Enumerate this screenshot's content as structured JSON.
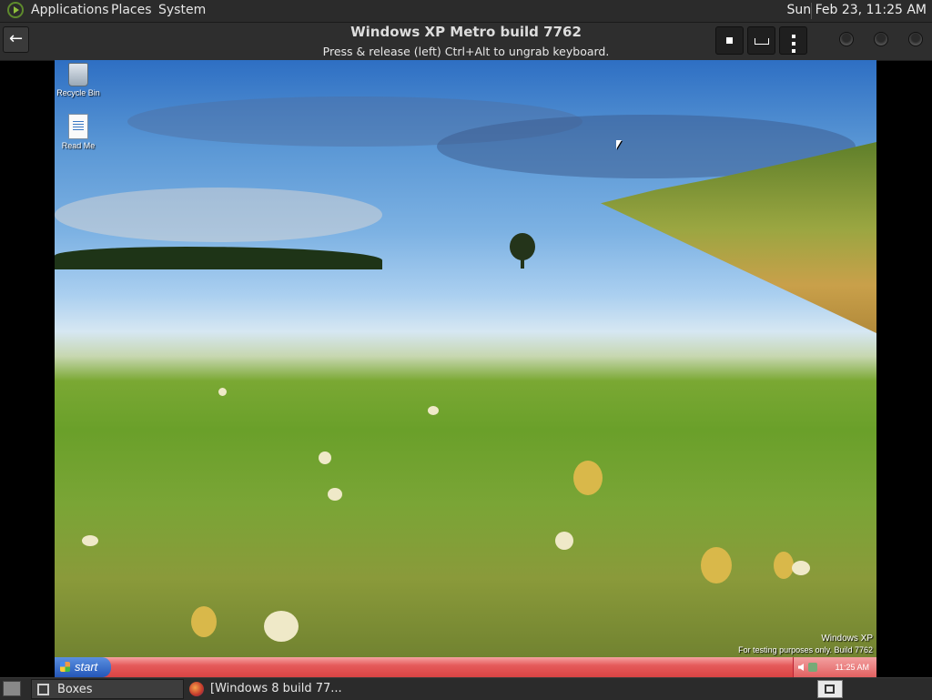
{
  "top_panel": {
    "menus": [
      "Applications",
      "Places",
      "System"
    ],
    "clock": "Sun Feb 23, 11:25 AM"
  },
  "header": {
    "title": "Windows XP Metro build 7762",
    "subtitle": "Press & release (left) Ctrl+Alt to ungrab keyboard.",
    "icons": {
      "back": "back-arrow-icon",
      "stop": "stop-icon",
      "keyboard": "keyboard-icon",
      "menu": "vertical-dots-icon"
    }
  },
  "vm": {
    "desktop_icons": [
      {
        "label": "Recycle Bin",
        "icon": "recycle-bin-icon"
      },
      {
        "label": "Read Me",
        "icon": "document-icon"
      }
    ],
    "watermark": {
      "line1": "Windows XP",
      "line2": "For testing purposes only. Build 7762"
    },
    "taskbar": {
      "start_label": "start",
      "tray_time": "11:25 AM"
    }
  },
  "bottom_panel": {
    "tasks": [
      {
        "label": "Boxes",
        "active": true
      },
      {
        "label": "[Windows 8 build 77...",
        "active": false
      }
    ]
  },
  "colors": {
    "panel_bg": "#2b2b2b",
    "xp_taskbar": "#e55b5b",
    "start_button": "#2456b8"
  }
}
